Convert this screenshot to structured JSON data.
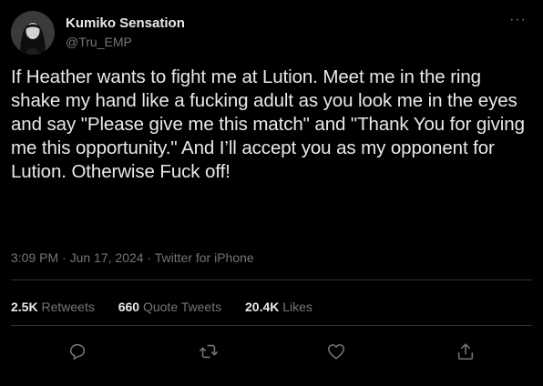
{
  "author": {
    "display_name": "Kumiko Sensation",
    "handle": "@Tru_EMP",
    "avatar_icon": "profile-photo"
  },
  "menu": {
    "more_icon": "···"
  },
  "tweet": {
    "text": "If Heather wants to fight me at Lution. Meet me in the ring shake my hand like a fucking adult as you look me in the eyes and say \"Please give me this match\" and \"Thank You for giving me this opportunity.\" And I’ll accept you as my opponent for Lution. Otherwise Fuck off!",
    "time": "3:09 PM",
    "date": "Jun 17, 2024",
    "source": "Twitter for iPhone",
    "separator": " · "
  },
  "stats": {
    "retweets_count": "2.5K",
    "retweets_label": "Retweets",
    "quotes_count": "660",
    "quotes_label": "Quote Tweets",
    "likes_count": "20.4K",
    "likes_label": "Likes"
  },
  "colors": {
    "background": "#000000",
    "text": "#e7e9ea",
    "secondary": "#71767b",
    "divider": "#2f3336"
  }
}
